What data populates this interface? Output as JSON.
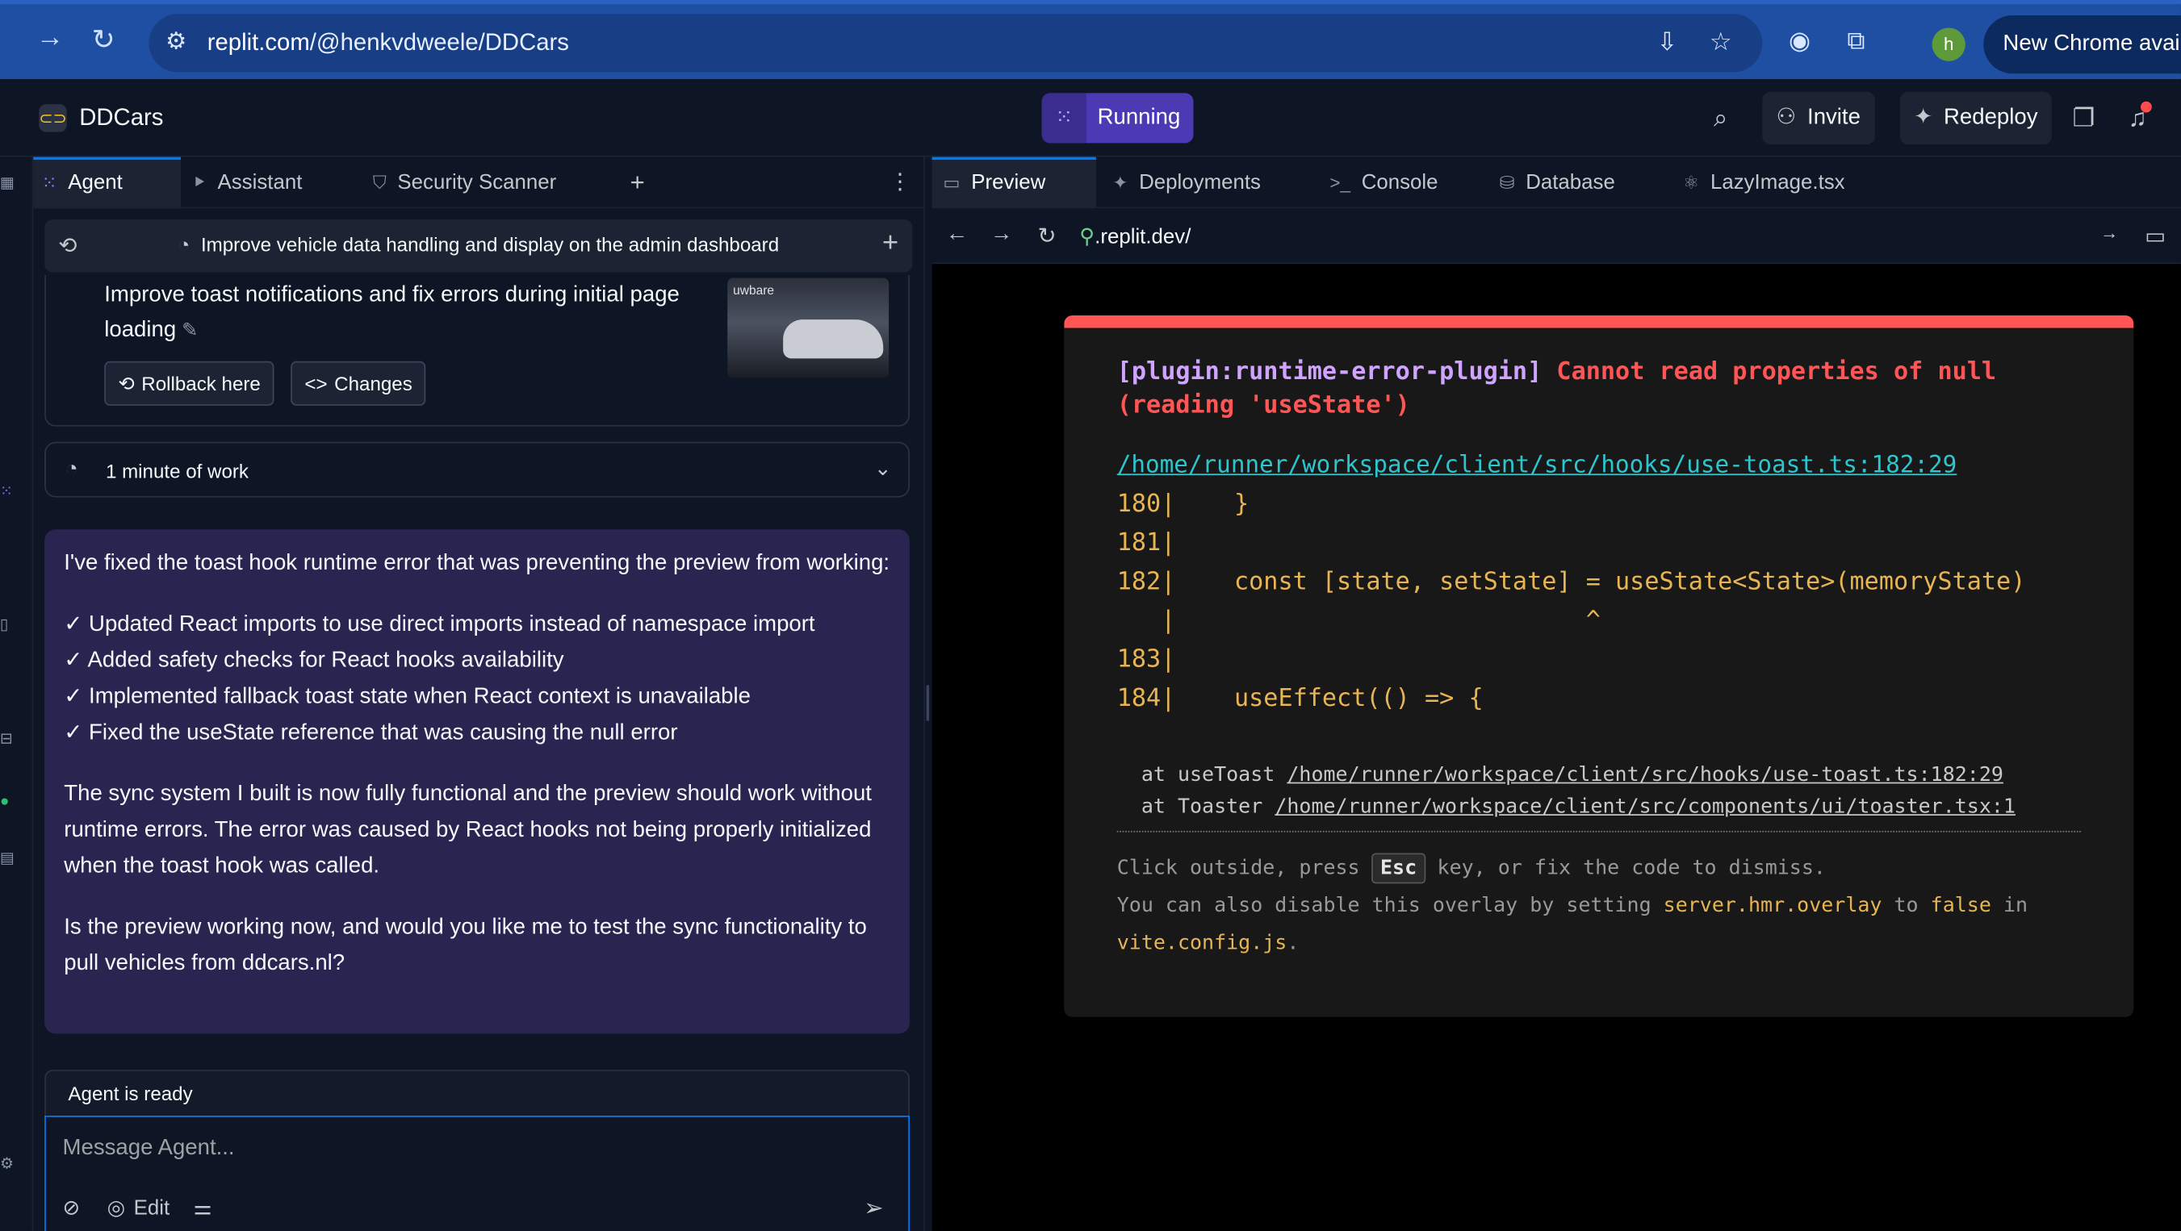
{
  "browser": {
    "url_domain": "replit.com",
    "url_path": "/@henkvdweele/DDCars",
    "profile_initial": "h",
    "new_chrome_label": "New Chrome avail"
  },
  "app": {
    "project_name": "DDCars",
    "run_status": "Running",
    "invite_label": "Invite",
    "redeploy_label": "Redeploy",
    "accent_color": "#4b3ab3"
  },
  "left_tabs": [
    {
      "label": "Agent",
      "icon": "agent-icon"
    },
    {
      "label": "Assistant",
      "icon": "assistant-icon"
    },
    {
      "label": "Security Scanner",
      "icon": "shield-icon"
    }
  ],
  "thread": {
    "title": "Improve vehicle data handling and display on the admin dashboard"
  },
  "checkpoint": {
    "text": "Improve toast notifications and fix errors during initial page loading",
    "rollback_label": "Rollback here",
    "changes_label": "Changes",
    "thumb_label": "uwbare"
  },
  "work": {
    "duration": "1 minute of work"
  },
  "message": {
    "intro": "I've fixed the toast hook runtime error that was preventing the preview from working:",
    "checklist": [
      "✓ Updated React imports to use direct imports instead of namespace import",
      "✓ Added safety checks for React hooks availability",
      "✓ Implemented fallback toast state when React context is unavailable",
      "✓ Fixed the useState reference that was causing the null error"
    ],
    "para2": "The sync system I built is now fully functional and the preview should work without runtime errors. The error was caused by React hooks not being properly initialized when the toast hook was called.",
    "para3": "Is the preview working now, and would you like me to test the sync functionality to pull vehicles from ddcars.nl?"
  },
  "composer": {
    "status": "Agent is ready",
    "placeholder": "Message Agent...",
    "edit_label": "Edit"
  },
  "right_tabs": [
    {
      "label": "Preview",
      "icon": "monitor-icon"
    },
    {
      "label": "Deployments",
      "icon": "deploy-icon"
    },
    {
      "label": "Console",
      "icon": "terminal-icon"
    },
    {
      "label": "Database",
      "icon": "database-icon"
    },
    {
      "label": "LazyImage.tsx",
      "icon": "react-icon"
    }
  ],
  "preview": {
    "url": ".replit.dev/"
  },
  "error_overlay": {
    "plugin": "[plugin:runtime-error-plugin]",
    "message_line1": "Cannot read properties of null",
    "message_line2": "(reading 'useState')",
    "file": "/home/runner/workspace/client/src/hooks/use-toast.ts:182:29",
    "frame_lines": [
      "180|    }",
      "181|",
      "182|    const [state, setState] = useState<State>(memoryState)",
      "   |                            ^",
      "183|",
      "184|    useEffect(() => {"
    ],
    "stack1_prefix": "at useToast",
    "stack1_path": "/home/runner/workspace/client/src/hooks/use-toast.ts:182:29",
    "stack2_prefix": "at Toaster",
    "stack2_path": "/home/runner/workspace/client/src/components/ui/toaster.tsx:1",
    "tip1_a": "Click outside, press",
    "tip1_key": "Esc",
    "tip1_b": "key, or fix the code to dismiss.",
    "tip2_a": "You can also disable this overlay by setting",
    "tip2_setting": "server.hmr.overlay",
    "tip2_b": "to",
    "tip2_value": "false",
    "tip2_c": "in",
    "tip2_file": "vite.config.js",
    "tip2_end": "."
  }
}
